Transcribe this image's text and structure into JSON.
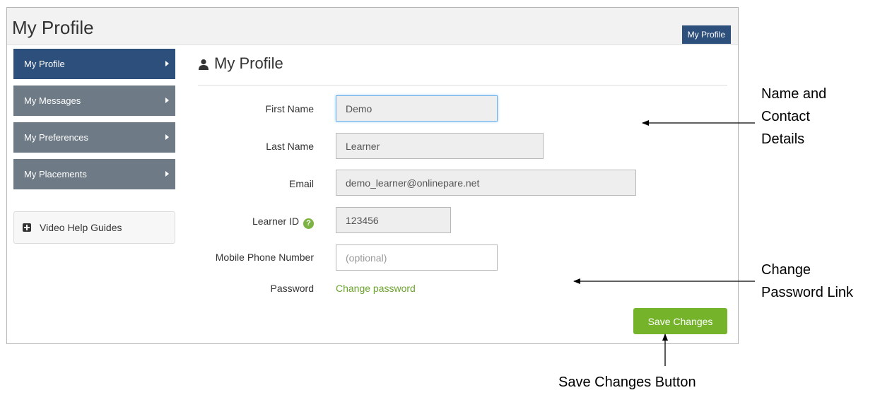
{
  "header": {
    "title": "My Profile",
    "breadcrumb": "My Profile"
  },
  "sidebar": {
    "items": [
      {
        "label": "My Profile",
        "active": true
      },
      {
        "label": "My Messages",
        "active": false
      },
      {
        "label": "My Preferences",
        "active": false
      },
      {
        "label": "My Placements",
        "active": false
      }
    ],
    "help_label": "Video Help Guides"
  },
  "main": {
    "title": "My Profile",
    "fields": {
      "first_name": {
        "label": "First Name",
        "value": "Demo"
      },
      "last_name": {
        "label": "Last Name",
        "value": "Learner"
      },
      "email": {
        "label": "Email",
        "value": "demo_learner@onlinepare.net"
      },
      "learner_id": {
        "label": "Learner ID",
        "value": "123456"
      },
      "mobile": {
        "label": "Mobile Phone Number",
        "value": "",
        "placeholder": "(optional)"
      },
      "password": {
        "label": "Password",
        "link": "Change password"
      }
    },
    "save_label": "Save Changes"
  },
  "annotations": {
    "name_contact": [
      "Name and",
      "Contact",
      "Details"
    ],
    "password_link": [
      "Change",
      "Password Link"
    ],
    "save_button": "Save Changes Button"
  },
  "colors": {
    "primary": "#2c4f7c",
    "nav": "#6e7a85",
    "accent_green": "#75b32b",
    "link_green": "#6aa32d"
  }
}
